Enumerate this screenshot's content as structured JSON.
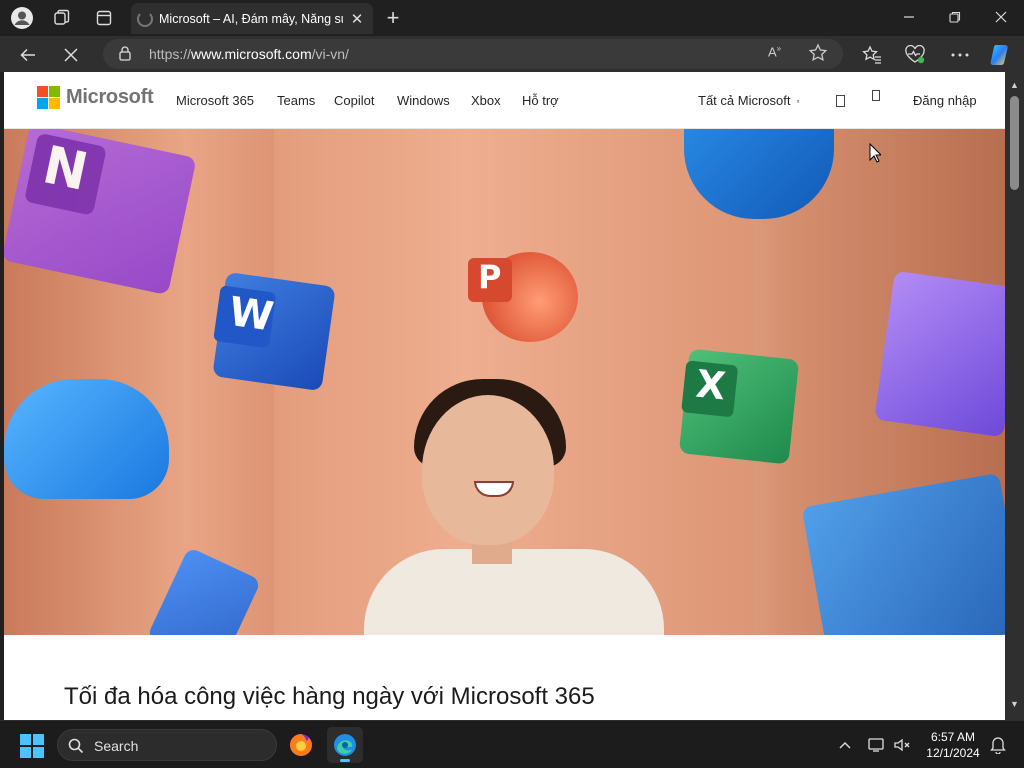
{
  "browser": {
    "tab_title": "Microsoft – AI, Đám mây, Năng su",
    "url_prefix": "https://",
    "url_domain": "www.microsoft.com",
    "url_path": "/vi-vn/"
  },
  "site": {
    "brand": "Microsoft",
    "nav": [
      "Microsoft 365",
      "Teams",
      "Copilot",
      "Windows",
      "Xbox",
      "Hỗ trợ"
    ],
    "all_microsoft": "Tất cả Microsoft",
    "signin": "Đăng nhập",
    "headline": "Tối đa hóa công việc hàng ngày với Microsoft 365",
    "logo_colors": [
      "#f25022",
      "#7fba00",
      "#00a4ef",
      "#ffb900"
    ]
  },
  "taskbar": {
    "search_label": "Search",
    "time": "6:57 AM",
    "date": "12/1/2024"
  },
  "colors": {
    "accent": "#4cc2ff",
    "hero_bg": "#e8a585"
  }
}
